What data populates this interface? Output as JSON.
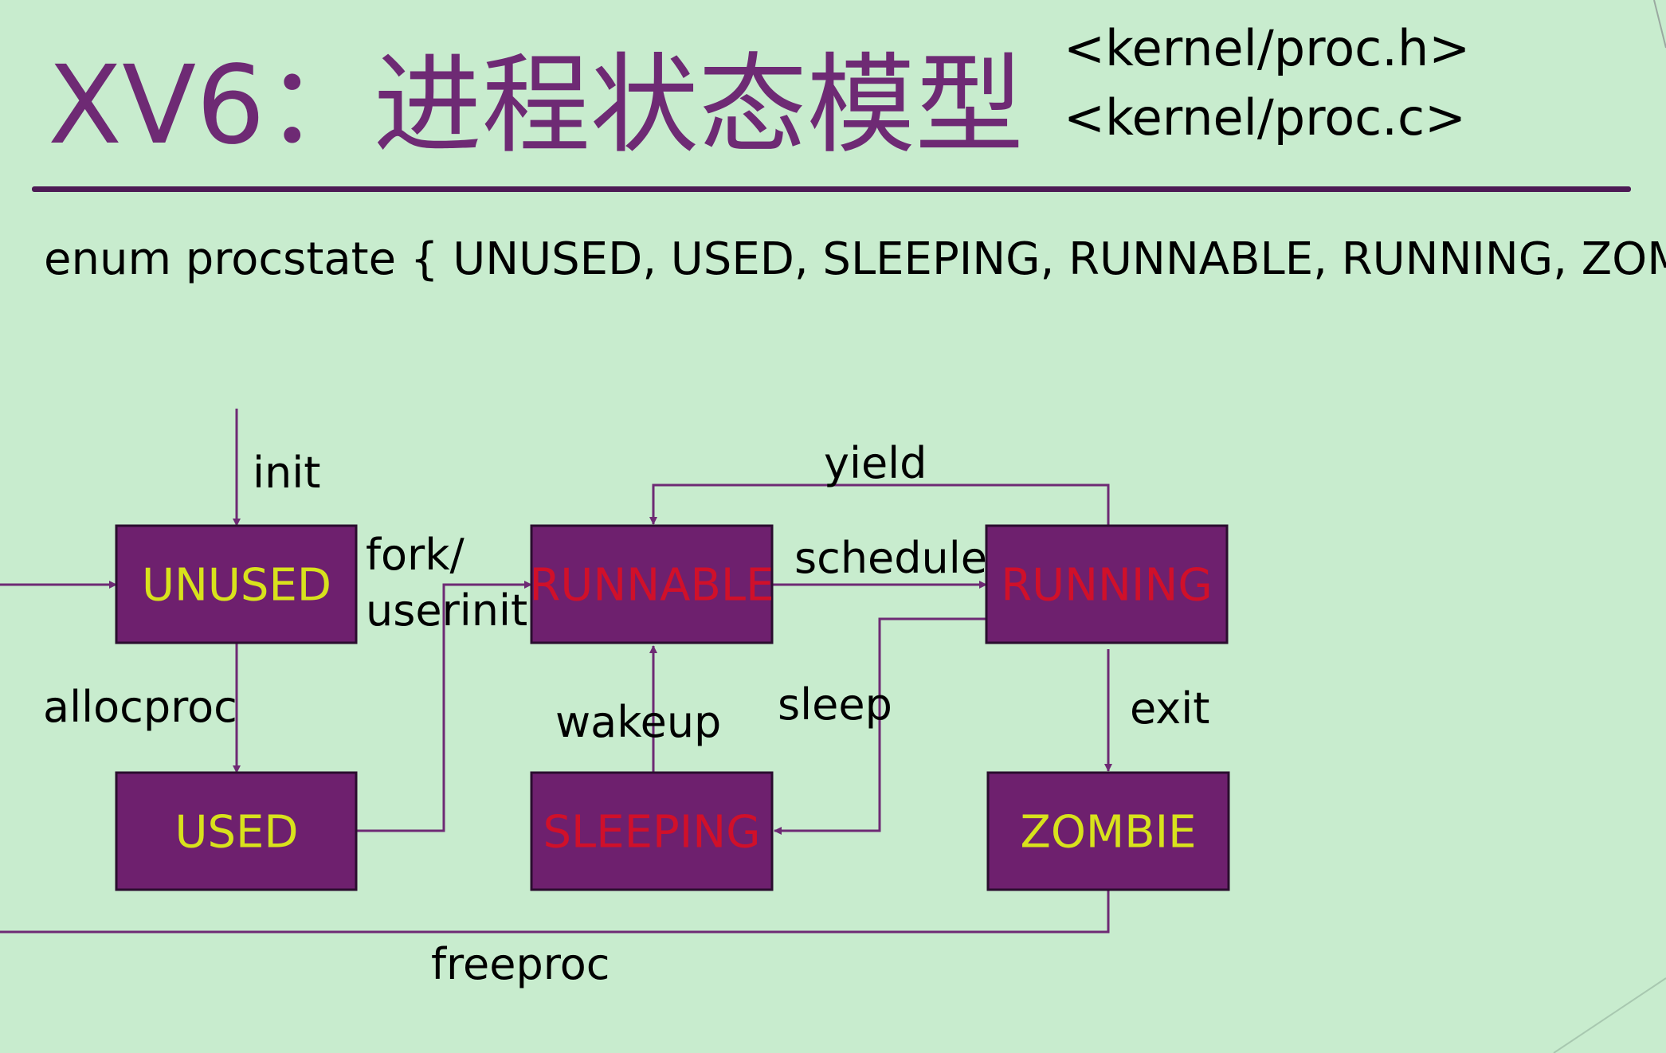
{
  "title": "XV6：进程状态模型",
  "subtitle": [
    "<kernel/proc.h>",
    "<kernel/proc.c>"
  ],
  "enum_line": "enum procstate { UNUSED, USED, SLEEPING, RUNNABLE, RUNNING, ZOMBIE };",
  "colors": {
    "background": "#c8ecce",
    "title": "#6e2a74",
    "rule": "#4d1a55",
    "box_fill": "#6e206e",
    "arrow": "#6e2a74",
    "label_yellow": "#d8e21c",
    "label_red": "#d0102a"
  },
  "states": {
    "unused": "UNUSED",
    "used": "USED",
    "runnable": "RUNNABLE",
    "running": "RUNNING",
    "sleeping": "SLEEPING",
    "zombie": "ZOMBIE"
  },
  "transitions": {
    "init": "init",
    "fork": "fork/",
    "userinit": "userinit",
    "schedule": "schedule",
    "yield": "yield",
    "allocproc": "allocproc",
    "wakeup": "wakeup",
    "sleep": "sleep",
    "exit": "exit",
    "freeproc": "freeproc"
  }
}
